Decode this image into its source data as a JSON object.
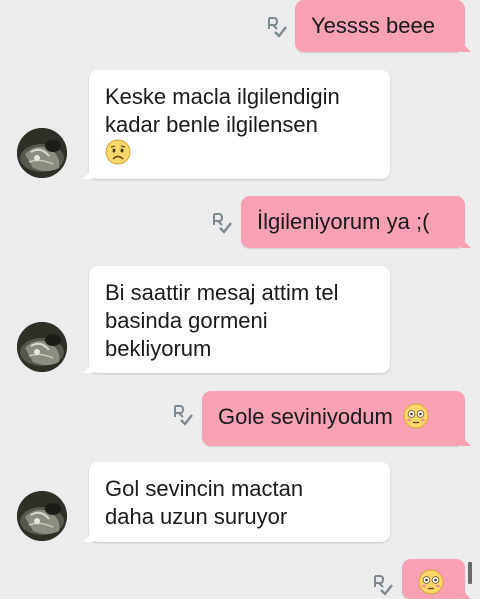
{
  "colors": {
    "background": "#ececec",
    "outgoing_bubble": "#f8a1b4",
    "incoming_bubble": "#ffffff"
  },
  "messages": [
    {
      "direction": "outgoing",
      "text": "Yessss beee",
      "status_icon": "read-receipt-icon"
    },
    {
      "direction": "incoming",
      "lines": [
        "Keske macla ilgilendigin",
        "kadar benle ilgilensen"
      ],
      "emoji": "worried-face-emoji",
      "avatar": "contact-avatar"
    },
    {
      "direction": "outgoing",
      "text": "İlgileniyorum ya ;(",
      "status_icon": "read-receipt-icon"
    },
    {
      "direction": "incoming",
      "lines": [
        "Bi saattir mesaj attim tel",
        "basinda gormeni",
        "bekliyorum"
      ],
      "avatar": "contact-avatar"
    },
    {
      "direction": "outgoing",
      "text": "Gole seviniyodum",
      "emoji": "flushed-face-emoji",
      "status_icon": "read-receipt-icon"
    },
    {
      "direction": "incoming",
      "lines": [
        "Gol sevincin mactan",
        "daha uzun suruyor"
      ],
      "avatar": "contact-avatar"
    },
    {
      "direction": "outgoing",
      "emoji": "flushed-face-emoji",
      "status_icon": "read-receipt-icon",
      "partial": true
    }
  ]
}
